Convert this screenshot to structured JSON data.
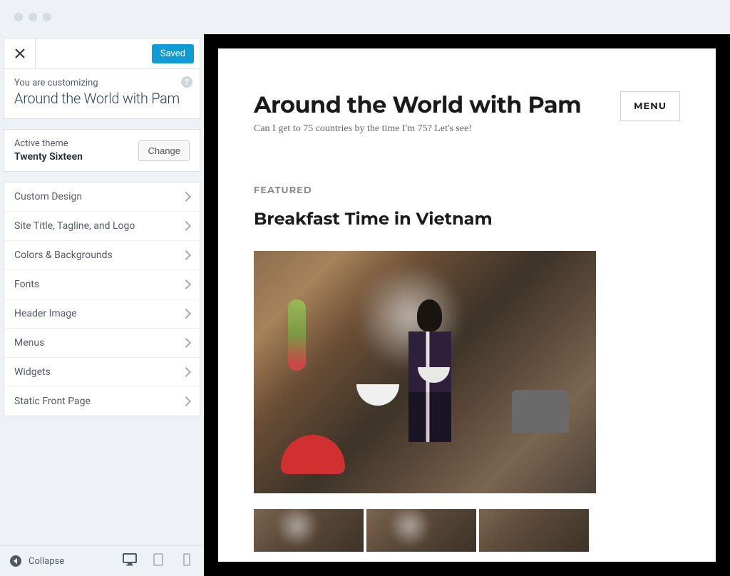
{
  "sidebar": {
    "saved_button": "Saved",
    "customizing_label": "You are customizing",
    "site_name": "Around the World with Pam",
    "active_theme_label": "Active theme",
    "theme_name": "Twenty Sixteen",
    "change_button": "Change",
    "menu_items": [
      "Custom Design",
      "Site Title, Tagline, and Logo",
      "Colors & Backgrounds",
      "Fonts",
      "Header Image",
      "Menus",
      "Widgets",
      "Static Front Page"
    ],
    "collapse": "Collapse"
  },
  "preview": {
    "site_title": "Around the World with Pam",
    "site_tagline": "Can I get to 75 countries by the time I'm 75? Let's see!",
    "menu_button": "MENU",
    "featured_label": "FEATURED",
    "post_title": "Breakfast Time in Vietnam"
  }
}
